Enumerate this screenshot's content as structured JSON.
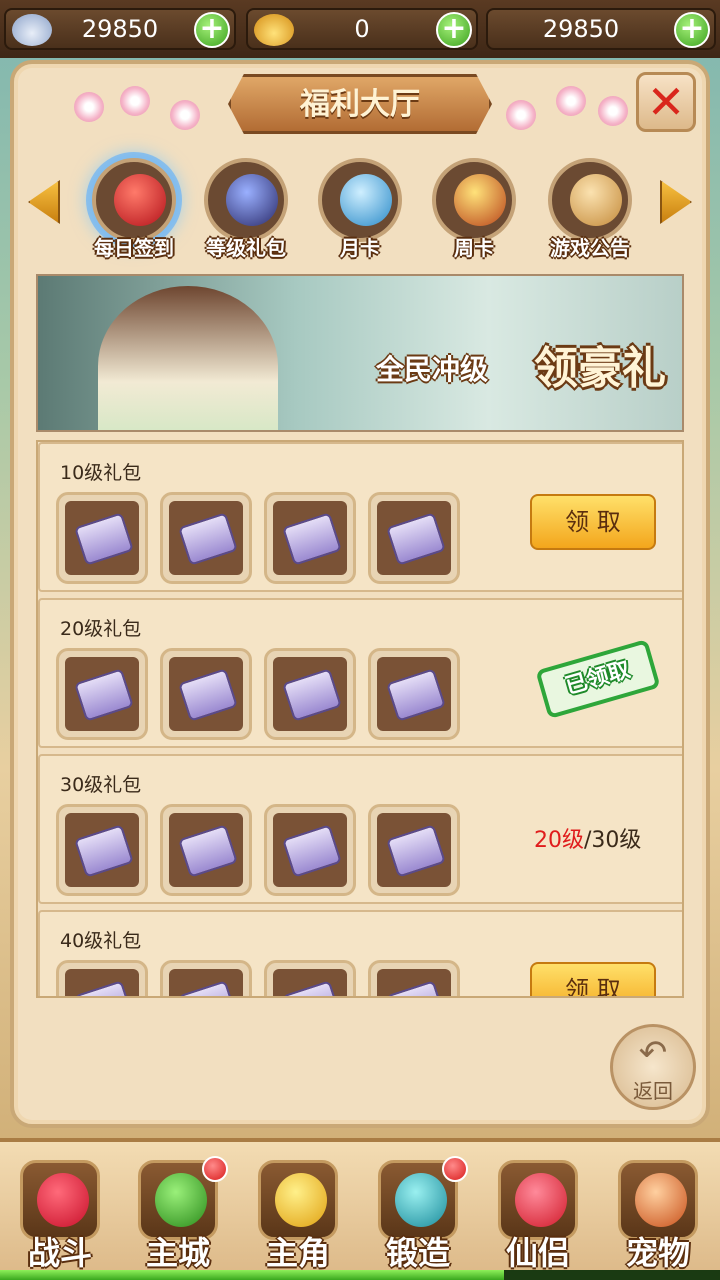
{
  "topbar": {
    "silver": {
      "icon": "silver-ingot-icon",
      "value": "29850"
    },
    "gold": {
      "icon": "gold-ingot-icon",
      "value": "0"
    },
    "stamina": {
      "value": "29850"
    }
  },
  "panel": {
    "title": "福利大厅",
    "tabs": [
      {
        "label": "每日签到",
        "icon": "red-orb-icon",
        "selected": true
      },
      {
        "label": "等级礼包",
        "icon": "constellation-icon",
        "selected": false
      },
      {
        "label": "月卡",
        "icon": "peacock-icon",
        "selected": false
      },
      {
        "label": "周卡",
        "icon": "medal-icon",
        "selected": false
      },
      {
        "label": "游戏公告",
        "icon": "scroll-icon",
        "selected": false
      }
    ],
    "banner": {
      "line1": "全民冲级",
      "line2": "领豪礼"
    },
    "rows": [
      {
        "title": "10级礼包",
        "action": "领 取"
      },
      {
        "title": "20级礼包",
        "stamp": "已领取"
      },
      {
        "title": "30级礼包",
        "progress_current": "20级",
        "progress_sep": "/",
        "progress_target": "30级"
      },
      {
        "title": "40级礼包",
        "action": "领 取"
      }
    ],
    "back_label": "返回"
  },
  "bottom_nav": [
    {
      "label": "战斗",
      "icon": "red-warrior-icon",
      "badge": false
    },
    {
      "label": "主城",
      "icon": "city-gate-icon",
      "badge": true
    },
    {
      "label": "主角",
      "icon": "yellow-hero-icon",
      "badge": false
    },
    {
      "label": "锻造",
      "icon": "hammer-icon",
      "badge": true
    },
    {
      "label": "仙侣",
      "icon": "heart-flower-icon",
      "badge": false
    },
    {
      "label": "宠物",
      "icon": "monkey-icon",
      "badge": false
    }
  ],
  "xp_fraction": 0.7,
  "colors": {
    "accent": "#f3a61c",
    "claimed": "#2ea63a",
    "progress_current": "#e01c1c"
  }
}
